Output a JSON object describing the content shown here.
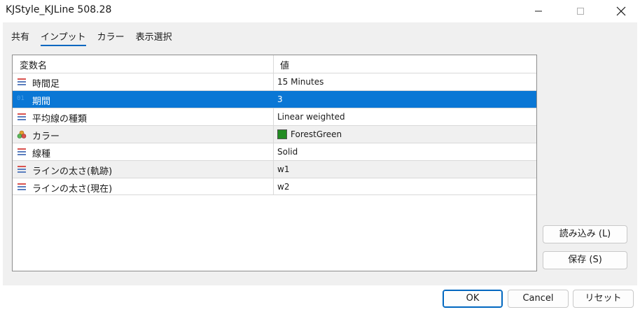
{
  "window": {
    "title": "KJStyle_KJLine 508.28"
  },
  "tabs": [
    {
      "label": "共有"
    },
    {
      "label": "インプット"
    },
    {
      "label": "カラー"
    },
    {
      "label": "表示選択"
    }
  ],
  "active_tab": "インプット",
  "grid": {
    "header_name": "変数名",
    "header_value": "値",
    "rows": [
      {
        "name": "時間足",
        "value": "15 Minutes",
        "icon": "list-icon"
      },
      {
        "name": "期間",
        "value": "3",
        "icon": "number-icon",
        "icon_text": "01"
      },
      {
        "name": "平均線の種類",
        "value": "Linear weighted",
        "icon": "list-icon"
      },
      {
        "name": "カラー",
        "value": "ForestGreen",
        "icon": "color-palette-icon",
        "swatch_color": "#228b22"
      },
      {
        "name": "線種",
        "value": "Solid",
        "icon": "list-icon"
      },
      {
        "name": "ラインの太さ(軌跡)",
        "value": "w1",
        "icon": "list-icon"
      },
      {
        "name": "ラインの太さ(現在)",
        "value": "w2",
        "icon": "list-icon"
      }
    ],
    "selected_row": "期間"
  },
  "side_buttons": {
    "load": "読み込み (L)",
    "save": "保存 (S)"
  },
  "bottom_buttons": {
    "ok": "OK",
    "cancel": "Cancel",
    "reset": "リセット"
  },
  "colors": {
    "selection": "#0a77d5",
    "accent": "#0067c0",
    "swatch": "#228b22"
  }
}
